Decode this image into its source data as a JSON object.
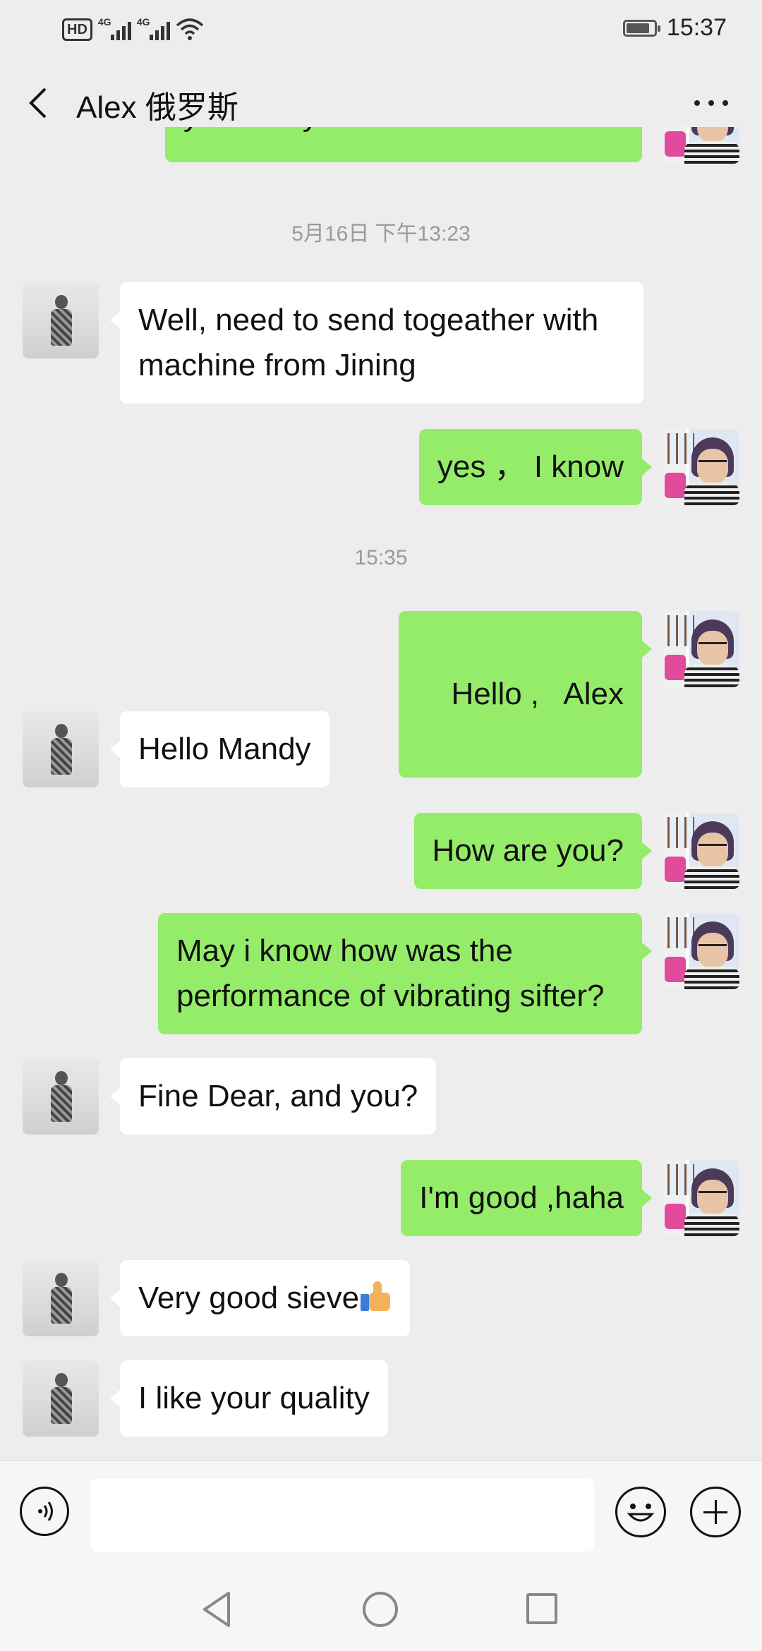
{
  "status_bar": {
    "hd_label": "HD",
    "network_1": "4G",
    "network_2": "4G",
    "time": "15:37"
  },
  "header": {
    "title": "Alex 俄罗斯"
  },
  "chat": {
    "partial_top_text": "yesterday discussed with Siara",
    "timestamp_1": "5月16日 下午13:23",
    "timestamp_2": "15:35",
    "messages": [
      {
        "side": "in",
        "text": "Well, need to send togeather with machine from Jining"
      },
      {
        "side": "out",
        "text": "yes ， I know"
      },
      {
        "side": "out",
        "text": "Hello ,   Alex"
      },
      {
        "side": "in",
        "text": "Hello Mandy"
      },
      {
        "side": "out",
        "text": "How are you?"
      },
      {
        "side": "out",
        "text": "May i know how was the performance of vibrating sifter?"
      },
      {
        "side": "in",
        "text": "Fine Dear, and you?"
      },
      {
        "side": "out",
        "text": "I'm good ,haha"
      },
      {
        "side": "in",
        "text": "Very good sieve",
        "emoji": "thumbs-up"
      },
      {
        "side": "in",
        "text": "I like your quality"
      }
    ]
  },
  "input_bar": {
    "placeholder": ""
  },
  "colors": {
    "background": "#ededed",
    "outgoing_bubble": "#95ec69",
    "incoming_bubble": "#ffffff"
  }
}
